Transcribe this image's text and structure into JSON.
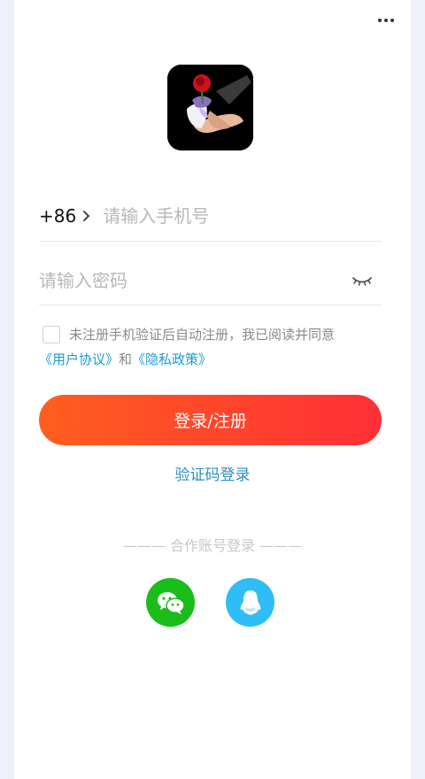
{
  "country_code": "+86",
  "phone": {
    "placeholder": "请输入手机号"
  },
  "password": {
    "placeholder": "请输入密码"
  },
  "agreement": {
    "text_prefix": "未注册手机验证后自动注册，我已阅读并同意",
    "user_agreement_link": "《用户协议》",
    "and_text": "和",
    "privacy_policy_link": "《隐私政策》"
  },
  "login_button_label": "登录/注册",
  "sms_login_label": "验证码登录",
  "partner_login_title": "——— 合作账号登录 ———",
  "icons": {
    "more": "more-icon",
    "eye": "eye-closed-icon",
    "wechat": "wechat-icon",
    "qq": "qq-icon",
    "chevron": "chevron-right-icon"
  },
  "colors": {
    "primary_gradient_start": "#ff5e1f",
    "primary_gradient_end": "#ff2f36",
    "link": "#1c9bd6",
    "wechat": "#1bbd1b",
    "qq": "#2fbdf6"
  }
}
